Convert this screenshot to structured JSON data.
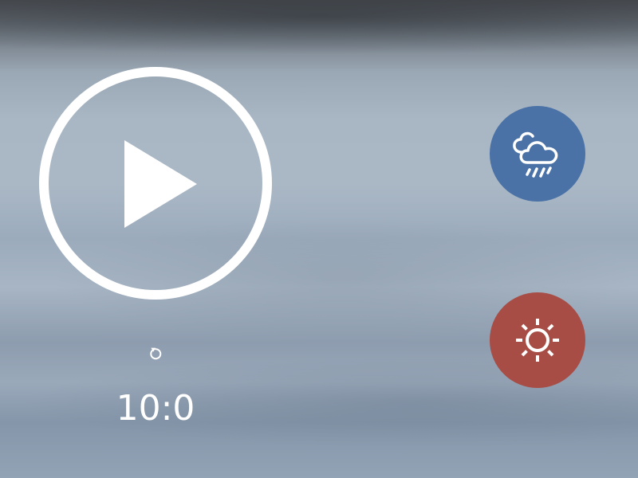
{
  "timer": {
    "display": "10:0"
  },
  "icons": {
    "play": "play-icon",
    "reset": "restart-icon",
    "rain": "cloud-rain-icon",
    "sun": "sun-icon"
  },
  "colors": {
    "rain_button": "#4a72a6",
    "sun_button": "#a84d45",
    "foreground": "#ffffff"
  }
}
